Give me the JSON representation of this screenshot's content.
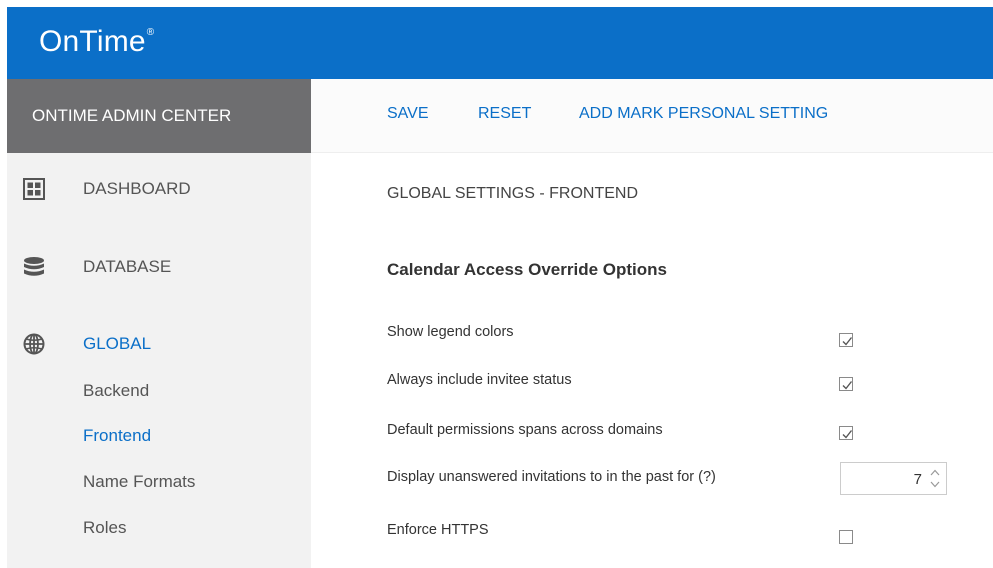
{
  "app": {
    "logo": "OnTime",
    "logo_mark": "®"
  },
  "sidebar": {
    "header": "ONTIME ADMIN CENTER",
    "items": [
      {
        "label": "DASHBOARD",
        "icon": "grid-icon"
      },
      {
        "label": "DATABASE",
        "icon": "database-icon"
      },
      {
        "label": "GLOBAL",
        "icon": "globe-icon",
        "active": true
      }
    ],
    "subitems": [
      {
        "label": "Backend"
      },
      {
        "label": "Frontend",
        "active": true
      },
      {
        "label": "Name Formats"
      },
      {
        "label": "Roles"
      }
    ]
  },
  "toolbar": {
    "save_label": "SAVE",
    "reset_label": "RESET",
    "add_mark_label": "ADD MARK PERSONAL SETTING"
  },
  "main": {
    "page_title": "GLOBAL SETTINGS - FRONTEND",
    "section_title": "Calendar Access Override Options",
    "settings": [
      {
        "label": "Show legend colors",
        "type": "checkbox",
        "checked": true
      },
      {
        "label": "Always include invitee status",
        "type": "checkbox",
        "checked": true
      },
      {
        "label": "Default permissions spans across domains",
        "type": "checkbox",
        "checked": true
      },
      {
        "label": "Display unanswered invitations to in the past for (?)",
        "type": "number",
        "value": "7"
      },
      {
        "label": "Enforce HTTPS",
        "type": "checkbox",
        "checked": false
      }
    ]
  },
  "colors": {
    "accent": "#0b6fc8",
    "sidebar_header": "#6e6e70",
    "sidebar_bg": "#f2f2f2"
  }
}
